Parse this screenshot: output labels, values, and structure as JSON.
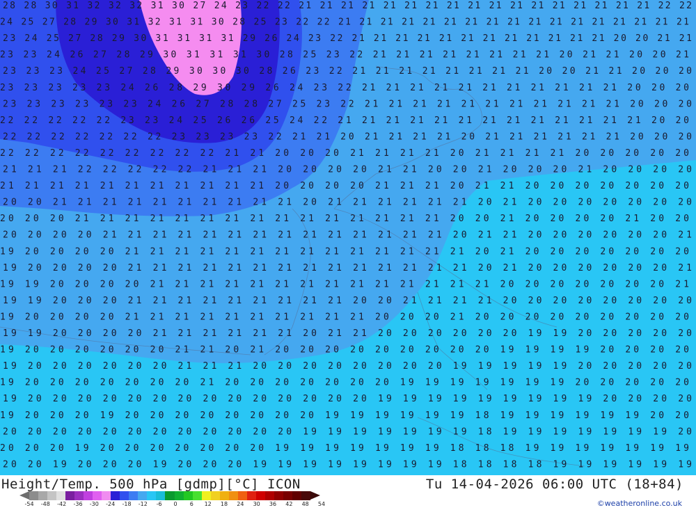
{
  "map": {
    "title": "Height/Temp. 500 hPa [gdmp][°C] ICON",
    "valid_time": "Tu 14-04-2026 06:00 UTC (18+84)",
    "credit": "©weatheronline.co.uk",
    "contour_labels": [
      {
        "row": 1,
        "text": "28 28 30 31 32 32 32 31 30 27 24 23 22 22 21 21 21 21 21 21 21 21 21 21 21 21 21 21 21 21 21 22 22"
      },
      {
        "row": 2,
        "text": "24 25 27 28 29 30 31 32 31 31 30 28 25 23 22 22 21 21 21 21 21 21 21 21 21 21 21 21 21 21 21 21 21"
      },
      {
        "row": 3,
        "text": "23 24 25 27 28 29 30 31 31 31 31 29 26 24 23 22 21 21 21 21 21 21 21 21 21 21 21 21 20 20 21 21"
      },
      {
        "row": 4,
        "text": "23 23 24 26 27 28 29 30 31 31 31 30 28 25 23 22 21 21 21 21 21 21 21 21 20 21 21 20 20 21"
      },
      {
        "row": 5,
        "text": "23 23 23 24 25 27 28 29 30 30 30 28 26 23 22 21 21 21 21 21 21 21 21 20 20 21 21 20 20 20"
      },
      {
        "row": 6,
        "text": "23 23 23 23 23 24 26 28 29 30 29 26 24 23 22 21 21 21 21 21 21 21 21 21 21 21 20 20 20"
      },
      {
        "row": 7,
        "text": "23 23 23 23 23 23 24 26 27 28 28 27 25 23 22 21 21 21 21 21 21 21 21 21 21 21 20 20 20"
      },
      {
        "row": 8,
        "text": "22 22 22 22 22 23 23 24 25 26 26 25 24 22 21 21 21 21 21 21 21 21 21 21 21 21 21 20 20"
      },
      {
        "row": 9,
        "text": "22 22 22 22 22 22 22 23 23 23 23 22 21 21 20 21 21 21 21 20 21 21 21 21 21 21 20 20 20"
      },
      {
        "row": 10,
        "text": "22 22 22 22 22 22 22 22 22 21 21 20 20 20 21 21 21 21 20 21 21 21 21 20 20 20 20 20"
      },
      {
        "row": 11,
        "text": "21 21 21 22 22 22 22 22 21 21 21 20 20 20 20 21 21 20 20 21 20 20 20 21 20 20 20 20"
      },
      {
        "row": 12,
        "text": "21 21 21 21 21 21 21 21 21 21 21 20 20 20 20 21 21 21 20 21 21 20 20 20 20 20 20 20"
      },
      {
        "row": 13,
        "text": "20 20 21 21 21 21 21 21 21 21 21 21 20 21 21 21 21 21 21 20 21 20 20 20 20 20 20 20"
      },
      {
        "row": 14,
        "text": "20 20 20 21 21 21 21 21 21 21 21 21 21 21 21 21 21 21 20 20 21 20 20 20 20 21 20 20"
      },
      {
        "row": 15,
        "text": "20 20 20 20 21 21 21 21 21 21 21 21 21 21 21 21 21 21 20 21 21 20 20 20 20 20 20 21"
      },
      {
        "row": 16,
        "text": "19 20 20 20 20 21 21 21 21 21 21 21 21 21 21 21 21 21 21 20 21 20 20 20 20 20 20 20"
      },
      {
        "row": 17,
        "text": "19 20 20 20 20 21 21 21 21 21 21 21 21 21 21 21 21 21 21 20 21 20 20 20 20 20 20 21"
      },
      {
        "row": 18,
        "text": "19 19 20 20 20 20 21 21 21 21 21 21 21 21 21 21 21 21 21 21 20 20 20 20 20 20 20 21"
      },
      {
        "row": 19,
        "text": "19 19 20 20 20 21 21 21 21 21 21 21 21 21 20 20 21 21 21 21 20 20 20 20 20 20 20 20"
      },
      {
        "row": 20,
        "text": "19 20 20 20 20 21 21 21 21 21 21 21 21 21 21 20 20 20 21 20 20 20 20 20 20 20 20 20"
      },
      {
        "row": 21,
        "text": "19 19 20 20 20 20 21 21 21 21 21 21 20 21 21 20 20 20 20 20 20 19 19 20 20 20 20 20"
      },
      {
        "row": 22,
        "text": "19 20 20 20 20 20 20 21 21 20 21 20 20 20 20 20 20 20 20 20 19 19 19 19 20 20 20 20"
      },
      {
        "row": 23,
        "text": "19 20 20 20 20 20 20 21 21 21 20 20 20 20 20 20 20 20 19 19 19 19 19 20 20 20 20 20"
      },
      {
        "row": 24,
        "text": "19 20 20 20 20 20 20 20 21 20 20 20 20 20 20 20 19 19 19 19 19 19 19 20 20 20 20 20"
      },
      {
        "row": 25,
        "text": "19 20 20 20 20 20 20 20 20 20 20 20 20 20 20 19 19 19 19 19 19 19 19 19 20 20 20 20"
      },
      {
        "row": 26,
        "text": "19 20 20 20 19 20 20 20 20 20 20 20 20 19 19 19 19 19 19 18 19 19 19 19 19 19 20 20"
      },
      {
        "row": 27,
        "text": "20 20 20 20 20 20 20 20 20 20 20 20 19 19 19 19 19 19 19 18 19 19 19 19 19 19 19 20"
      },
      {
        "row": 28,
        "text": "20 20 20 19 20 20 20 20 20 20 20 19 19 19 19 19 19 19 18 18 18 19 19 19 19 19 19 19"
      },
      {
        "row": 29,
        "text": "20 20 19 20 20 20 19 20 20 20 19 19 19 19 19 19 19 19 18 18 18 18 19 19 19 19 19 19"
      }
    ],
    "colors": {
      "background_cyan": "#29c6f5",
      "band_21": "#45a8f0",
      "band_22": "#3c7cf2",
      "band_24": "#3050ee",
      "band_27": "#2a1fd6",
      "band_30": "#f58cf0"
    }
  },
  "legend": {
    "ticks": [
      "-54",
      "-48",
      "-42",
      "-36",
      "-30",
      "-24",
      "-18",
      "-12",
      "-6",
      "0",
      "6",
      "12",
      "18",
      "24",
      "30",
      "36",
      "42",
      "48",
      "54"
    ],
    "colors": [
      "#8c8c8c",
      "#a8a8a8",
      "#c4c4c4",
      "#e0e0e0",
      "#7a1fa0",
      "#9b2fc0",
      "#c040e0",
      "#e060f0",
      "#f08cf0",
      "#2a1fd6",
      "#3050ee",
      "#3c7cf2",
      "#45a8f0",
      "#29c6f5",
      "#1abdd8",
      "#0a9a2e",
      "#10b030",
      "#22c822",
      "#48e030",
      "#f0f020",
      "#f0d020",
      "#f0b010",
      "#f09010",
      "#f06010",
      "#e02010",
      "#d00000",
      "#b00000",
      "#900000",
      "#780000",
      "#600000",
      "#480808"
    ]
  }
}
